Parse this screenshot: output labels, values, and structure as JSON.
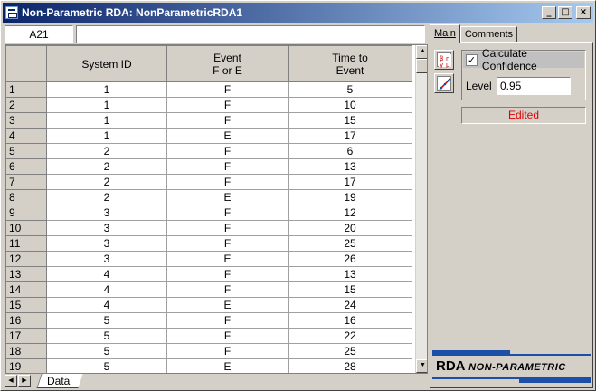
{
  "window": {
    "title": "Non-Parametric RDA: NonParametricRDA1",
    "minimize": "_",
    "maximize": "□",
    "close": "×"
  },
  "refbar": {
    "cell_ref": "A21",
    "formula": ""
  },
  "grid": {
    "columns": [
      "System ID",
      "Event\nF or E",
      "Time to\nEvent"
    ],
    "rows": [
      {
        "n": "1",
        "cells": [
          "1",
          "F",
          "5"
        ]
      },
      {
        "n": "2",
        "cells": [
          "1",
          "F",
          "10"
        ]
      },
      {
        "n": "3",
        "cells": [
          "1",
          "F",
          "15"
        ]
      },
      {
        "n": "4",
        "cells": [
          "1",
          "E",
          "17"
        ]
      },
      {
        "n": "5",
        "cells": [
          "2",
          "F",
          "6"
        ]
      },
      {
        "n": "6",
        "cells": [
          "2",
          "F",
          "13"
        ]
      },
      {
        "n": "7",
        "cells": [
          "2",
          "F",
          "17"
        ]
      },
      {
        "n": "8",
        "cells": [
          "2",
          "E",
          "19"
        ]
      },
      {
        "n": "9",
        "cells": [
          "3",
          "F",
          "12"
        ]
      },
      {
        "n": "10",
        "cells": [
          "3",
          "F",
          "20"
        ]
      },
      {
        "n": "11",
        "cells": [
          "3",
          "F",
          "25"
        ]
      },
      {
        "n": "12",
        "cells": [
          "3",
          "E",
          "26"
        ]
      },
      {
        "n": "13",
        "cells": [
          "4",
          "F",
          "13"
        ]
      },
      {
        "n": "14",
        "cells": [
          "4",
          "F",
          "15"
        ]
      },
      {
        "n": "15",
        "cells": [
          "4",
          "E",
          "24"
        ]
      },
      {
        "n": "16",
        "cells": [
          "5",
          "F",
          "16"
        ]
      },
      {
        "n": "17",
        "cells": [
          "5",
          "F",
          "22"
        ]
      },
      {
        "n": "18",
        "cells": [
          "5",
          "F",
          "25"
        ]
      },
      {
        "n": "19",
        "cells": [
          "5",
          "E",
          "28"
        ]
      }
    ]
  },
  "sheet_tabs": {
    "active": "Data"
  },
  "panel": {
    "tabs": [
      "Main",
      "Comments"
    ],
    "calculate_confidence": {
      "label": "Calculate Confidence",
      "checked": true,
      "check_glyph": "✓"
    },
    "level": {
      "label": "Level",
      "value": "0.95"
    },
    "status": "Edited",
    "logo": {
      "main": "RDA",
      "sub": "NON-PARAMETRIC"
    }
  },
  "colors": {
    "title_gradient_start": "#0a246a",
    "status_text": "#e00000",
    "logo_accent": "#1b4fa8"
  }
}
